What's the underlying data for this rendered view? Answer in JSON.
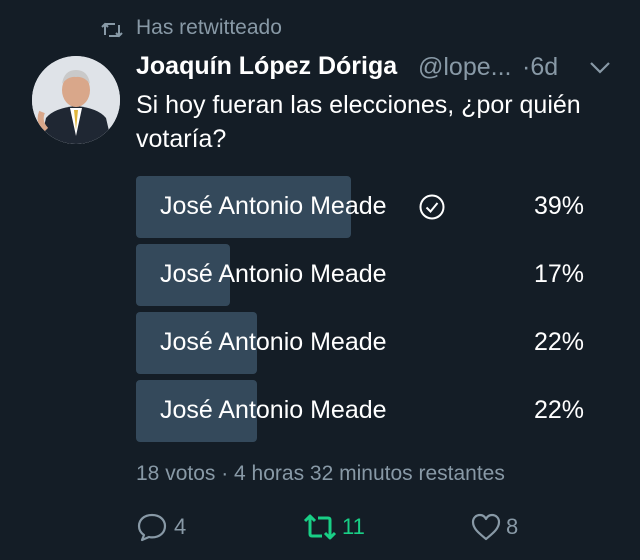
{
  "retweet_banner": {
    "text": "Has retwitteado",
    "icon": "retweet-icon"
  },
  "tweet": {
    "author_name": "Joaquín López Dóriga",
    "handle": "@lope...",
    "time": "·6d",
    "text": "Si hoy fueran las elecciones, ¿por quién votaría?"
  },
  "poll": {
    "options": [
      {
        "label": "José Antonio Meade",
        "percent_label": "39%",
        "percent": 39,
        "selected": true
      },
      {
        "label": "José Antonio Meade",
        "percent_label": "17%",
        "percent": 17,
        "selected": false
      },
      {
        "label": "José Antonio Meade",
        "percent_label": "22%",
        "percent": 22,
        "selected": false
      },
      {
        "label": "José Antonio Meade",
        "percent_label": "22%",
        "percent": 22,
        "selected": false
      }
    ],
    "meta": "18 votos · 4 horas 32 minutos restantes"
  },
  "actions": {
    "replies": "4",
    "retweets": "11",
    "likes": "8"
  },
  "colors": {
    "background": "#141d26",
    "bar": "#34495b",
    "muted": "#8899a6",
    "retweet_active": "#19cf86"
  }
}
